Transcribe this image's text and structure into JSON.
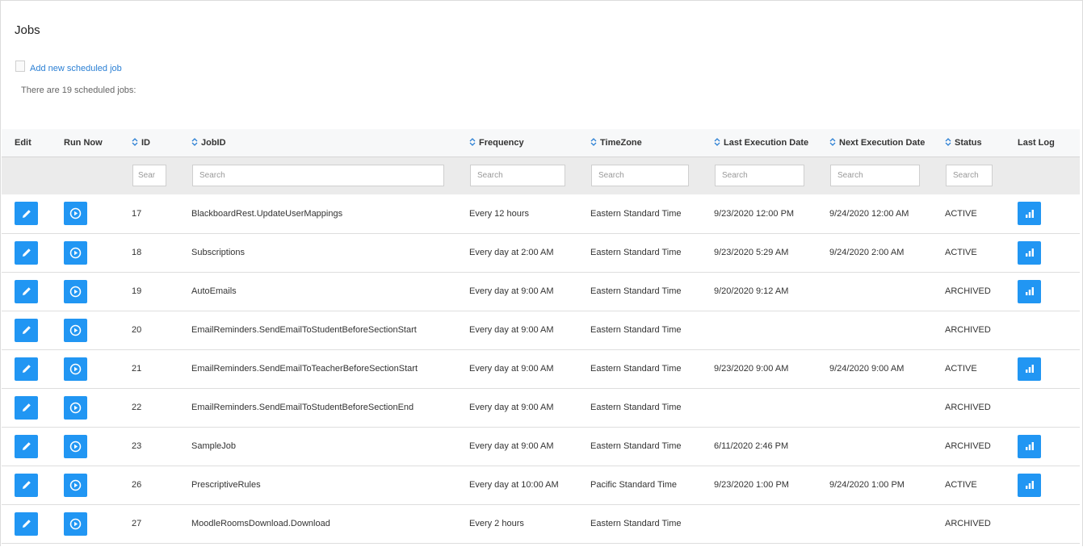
{
  "page": {
    "title": "Jobs",
    "add_link": "Add new scheduled job",
    "count_text": "There are 19 scheduled jobs:"
  },
  "table": {
    "headers": {
      "edit": "Edit",
      "run_now": "Run Now",
      "id": "ID",
      "jobid": "JobID",
      "frequency": "Frequency",
      "timezone": "TimeZone",
      "last_exec": "Last Execution Date",
      "next_exec": "Next Execution Date",
      "status": "Status",
      "last_log": "Last Log"
    },
    "placeholders": {
      "id": "Sear",
      "jobid": "Search",
      "frequency": "Search",
      "timezone": "Search",
      "last_exec": "Search",
      "next_exec": "Search",
      "status": "Search"
    },
    "rows": [
      {
        "id": "17",
        "jobid": "BlackboardRest.UpdateUserMappings",
        "frequency": "Every 12 hours",
        "timezone": "Eastern Standard Time",
        "last_exec": "9/23/2020 12:00 PM",
        "next_exec": "9/24/2020 12:00 AM",
        "status": "ACTIVE",
        "has_log": true
      },
      {
        "id": "18",
        "jobid": "Subscriptions",
        "frequency": "Every day at 2:00 AM",
        "timezone": "Eastern Standard Time",
        "last_exec": "9/23/2020 5:29 AM",
        "next_exec": "9/24/2020 2:00 AM",
        "status": "ACTIVE",
        "has_log": true
      },
      {
        "id": "19",
        "jobid": "AutoEmails",
        "frequency": "Every day at 9:00 AM",
        "timezone": "Eastern Standard Time",
        "last_exec": "9/20/2020 9:12 AM",
        "next_exec": "",
        "status": "ARCHIVED",
        "has_log": true
      },
      {
        "id": "20",
        "jobid": "EmailReminders.SendEmailToStudentBeforeSectionStart",
        "frequency": "Every day at 9:00 AM",
        "timezone": "Eastern Standard Time",
        "last_exec": "",
        "next_exec": "",
        "status": "ARCHIVED",
        "has_log": false
      },
      {
        "id": "21",
        "jobid": "EmailReminders.SendEmailToTeacherBeforeSectionStart",
        "frequency": "Every day at 9:00 AM",
        "timezone": "Eastern Standard Time",
        "last_exec": "9/23/2020 9:00 AM",
        "next_exec": "9/24/2020 9:00 AM",
        "status": "ACTIVE",
        "has_log": true
      },
      {
        "id": "22",
        "jobid": "EmailReminders.SendEmailToStudentBeforeSectionEnd",
        "frequency": "Every day at 9:00 AM",
        "timezone": "Eastern Standard Time",
        "last_exec": "",
        "next_exec": "",
        "status": "ARCHIVED",
        "has_log": false
      },
      {
        "id": "23",
        "jobid": "SampleJob",
        "frequency": "Every day at 9:00 AM",
        "timezone": "Eastern Standard Time",
        "last_exec": "6/11/2020 2:46 PM",
        "next_exec": "",
        "status": "ARCHIVED",
        "has_log": true
      },
      {
        "id": "26",
        "jobid": "PrescriptiveRules",
        "frequency": "Every day at 10:00 AM",
        "timezone": "Pacific Standard Time",
        "last_exec": "9/23/2020 1:00 PM",
        "next_exec": "9/24/2020 1:00 PM",
        "status": "ACTIVE",
        "has_log": true
      },
      {
        "id": "27",
        "jobid": "MoodleRoomsDownload.Download",
        "frequency": "Every 2 hours",
        "timezone": "Eastern Standard Time",
        "last_exec": "",
        "next_exec": "",
        "status": "ARCHIVED",
        "has_log": false
      }
    ]
  },
  "icons": {
    "edit": "pencil-icon",
    "run": "play-circle-icon",
    "log": "bar-chart-icon",
    "sort": "sort-arrows-icon",
    "add": "document-icon"
  },
  "colors": {
    "accent": "#2196f3",
    "link": "#2a7fd4"
  }
}
